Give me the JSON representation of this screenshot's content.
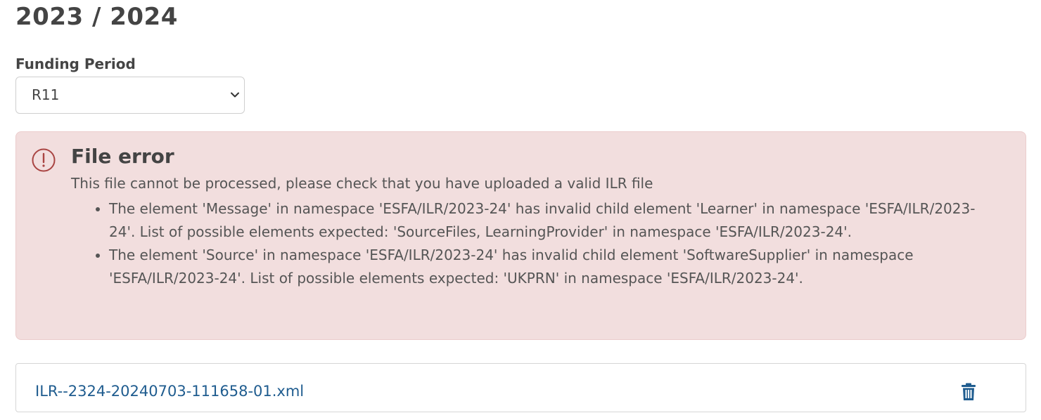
{
  "header": {
    "title": "2023 / 2024"
  },
  "funding_period": {
    "label": "Funding Period",
    "selected": "R11"
  },
  "alert": {
    "title": "File error",
    "message": "This file cannot be processed, please check that you have uploaded a valid ILR file",
    "errors": [
      "The element 'Message' in namespace 'ESFA/ILR/2023-24' has invalid child element 'Learner' in namespace 'ESFA/ILR/2023-24'. List of possible elements expected: 'SourceFiles, LearningProvider' in namespace 'ESFA/ILR/2023-24'.",
      "The element 'Source' in namespace 'ESFA/ILR/2023-24' has invalid child element 'SoftwareSupplier' in namespace 'ESFA/ILR/2023-24'. List of possible elements expected: 'UKPRN' in namespace 'ESFA/ILR/2023-24'."
    ],
    "icon": "alert-circle-icon",
    "color": "#a94442"
  },
  "file": {
    "name": "ILR--2324-20240703-111658-01.xml",
    "delete_icon": "trash-icon",
    "link_color": "#1f5c8f"
  }
}
